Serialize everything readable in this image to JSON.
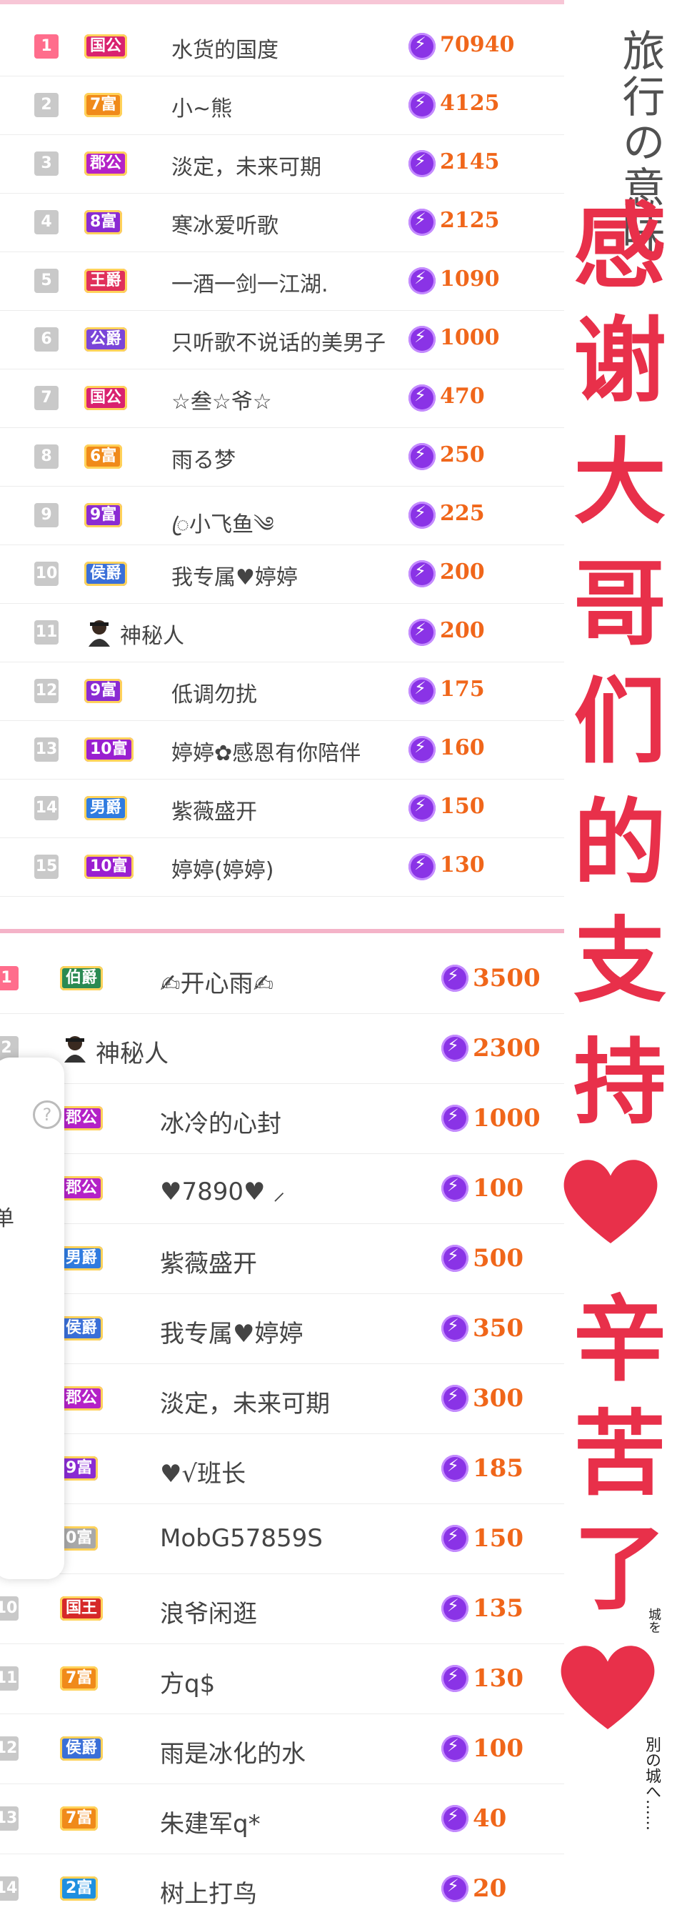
{
  "top_list": [
    {
      "rank": "1",
      "badge": "国公",
      "badge_color": "#d9226f",
      "name": "水货的国度",
      "score": "70940"
    },
    {
      "rank": "2",
      "badge": "7富",
      "badge_color": "#f08a1a",
      "name": "小~熊",
      "score": "4125"
    },
    {
      "rank": "3",
      "badge": "郡公",
      "badge_color": "#b422c7",
      "name": "淡定，未来可期",
      "score": "2145"
    },
    {
      "rank": "4",
      "badge": "8富",
      "badge_color": "#8a2bd3",
      "name": "寒冰爱听歌",
      "score": "2125"
    },
    {
      "rank": "5",
      "badge": "王爵",
      "badge_color": "#e0305a",
      "name": "一酒一剑一江湖.",
      "score": "1090"
    },
    {
      "rank": "6",
      "badge": "公爵",
      "badge_color": "#7a45d8",
      "name": "只听歌不说话的美男子",
      "score": "1000"
    },
    {
      "rank": "7",
      "badge": "国公",
      "badge_color": "#d9226f",
      "name": "☆叁☆爷☆",
      "score": "470"
    },
    {
      "rank": "8",
      "badge": "6富",
      "badge_color": "#f08a1a",
      "name": "雨る梦",
      "score": "250"
    },
    {
      "rank": "9",
      "badge": "9富",
      "badge_color": "#8a2bd3",
      "name": "ꦿ小飞鱼༄",
      "score": "225"
    },
    {
      "rank": "10",
      "badge": "侯爵",
      "badge_color": "#3a6fd8",
      "name": "我专属♥婷婷",
      "score": "200"
    },
    {
      "rank": "11",
      "badge": "",
      "badge_color": "",
      "name": "神秘人",
      "score": "200"
    },
    {
      "rank": "12",
      "badge": "9富",
      "badge_color": "#8a2bd3",
      "name": "低调勿扰",
      "score": "175"
    },
    {
      "rank": "13",
      "badge": "10富",
      "badge_color": "#9a1fd0",
      "name": "婷婷✿感恩有你陪伴",
      "score": "160"
    },
    {
      "rank": "14",
      "badge": "男爵",
      "badge_color": "#2f7be0",
      "name": "紫薇盛开",
      "score": "150"
    },
    {
      "rank": "15",
      "badge": "10富",
      "badge_color": "#9a1fd0",
      "name": "婷婷(婷婷)",
      "score": "130"
    }
  ],
  "bottom_list": [
    {
      "rank": "1",
      "badge": "伯爵",
      "badge_color": "#2a8a52",
      "name": "✍开心雨✍",
      "score": "3500"
    },
    {
      "rank": "2",
      "badge": "",
      "badge_color": "",
      "name": "神秘人",
      "score": "2300"
    },
    {
      "rank": "",
      "badge": "郡公",
      "badge_color": "#b422c7",
      "name": "冰冷的心封",
      "score": "1000"
    },
    {
      "rank": "",
      "badge": "郡公",
      "badge_color": "#b422c7",
      "name": "♥7890♥ ⸝",
      "score": "100"
    },
    {
      "rank": "",
      "badge": "男爵",
      "badge_color": "#2f7be0",
      "name": "紫薇盛开",
      "score": "500"
    },
    {
      "rank": "",
      "badge": "侯爵",
      "badge_color": "#3a6fd8",
      "name": "我专属♥婷婷",
      "score": "350"
    },
    {
      "rank": "",
      "badge": "郡公",
      "badge_color": "#b422c7",
      "name": "淡定，未来可期",
      "score": "300"
    },
    {
      "rank": "",
      "badge": "9富",
      "badge_color": "#8a2bd3",
      "name": "♥√班长",
      "score": "185"
    },
    {
      "rank": "",
      "badge": "0富",
      "badge_color": "#a8a8a8",
      "name": "MobG57859S",
      "score": "150"
    },
    {
      "rank": "10",
      "badge": "国王",
      "badge_color": "#d62828",
      "name": "浪爷闲逛",
      "score": "135"
    },
    {
      "rank": "11",
      "badge": "7富",
      "badge_color": "#f08a1a",
      "name": "方q$",
      "score": "130"
    },
    {
      "rank": "12",
      "badge": "侯爵",
      "badge_color": "#3a6fd8",
      "name": "雨是冰化的水",
      "score": "100"
    },
    {
      "rank": "13",
      "badge": "7富",
      "badge_color": "#f08a1a",
      "name": "朱建军q*",
      "score": "40"
    },
    {
      "rank": "14",
      "badge": "2富",
      "badge_color": "#1e8fe0",
      "name": "树上打鸟",
      "score": "20"
    }
  ],
  "popup": {
    "help_icon": "?",
    "label": "单"
  },
  "overlay": {
    "chars": [
      "感",
      "谢",
      "大",
      "哥",
      "们",
      "的",
      "支",
      "持",
      "辛",
      "苦",
      "了"
    ],
    "corner_text_top": "旅行の意味",
    "corner_text_bottom": "別の城へ……",
    "corner_text_mid": "城を"
  }
}
